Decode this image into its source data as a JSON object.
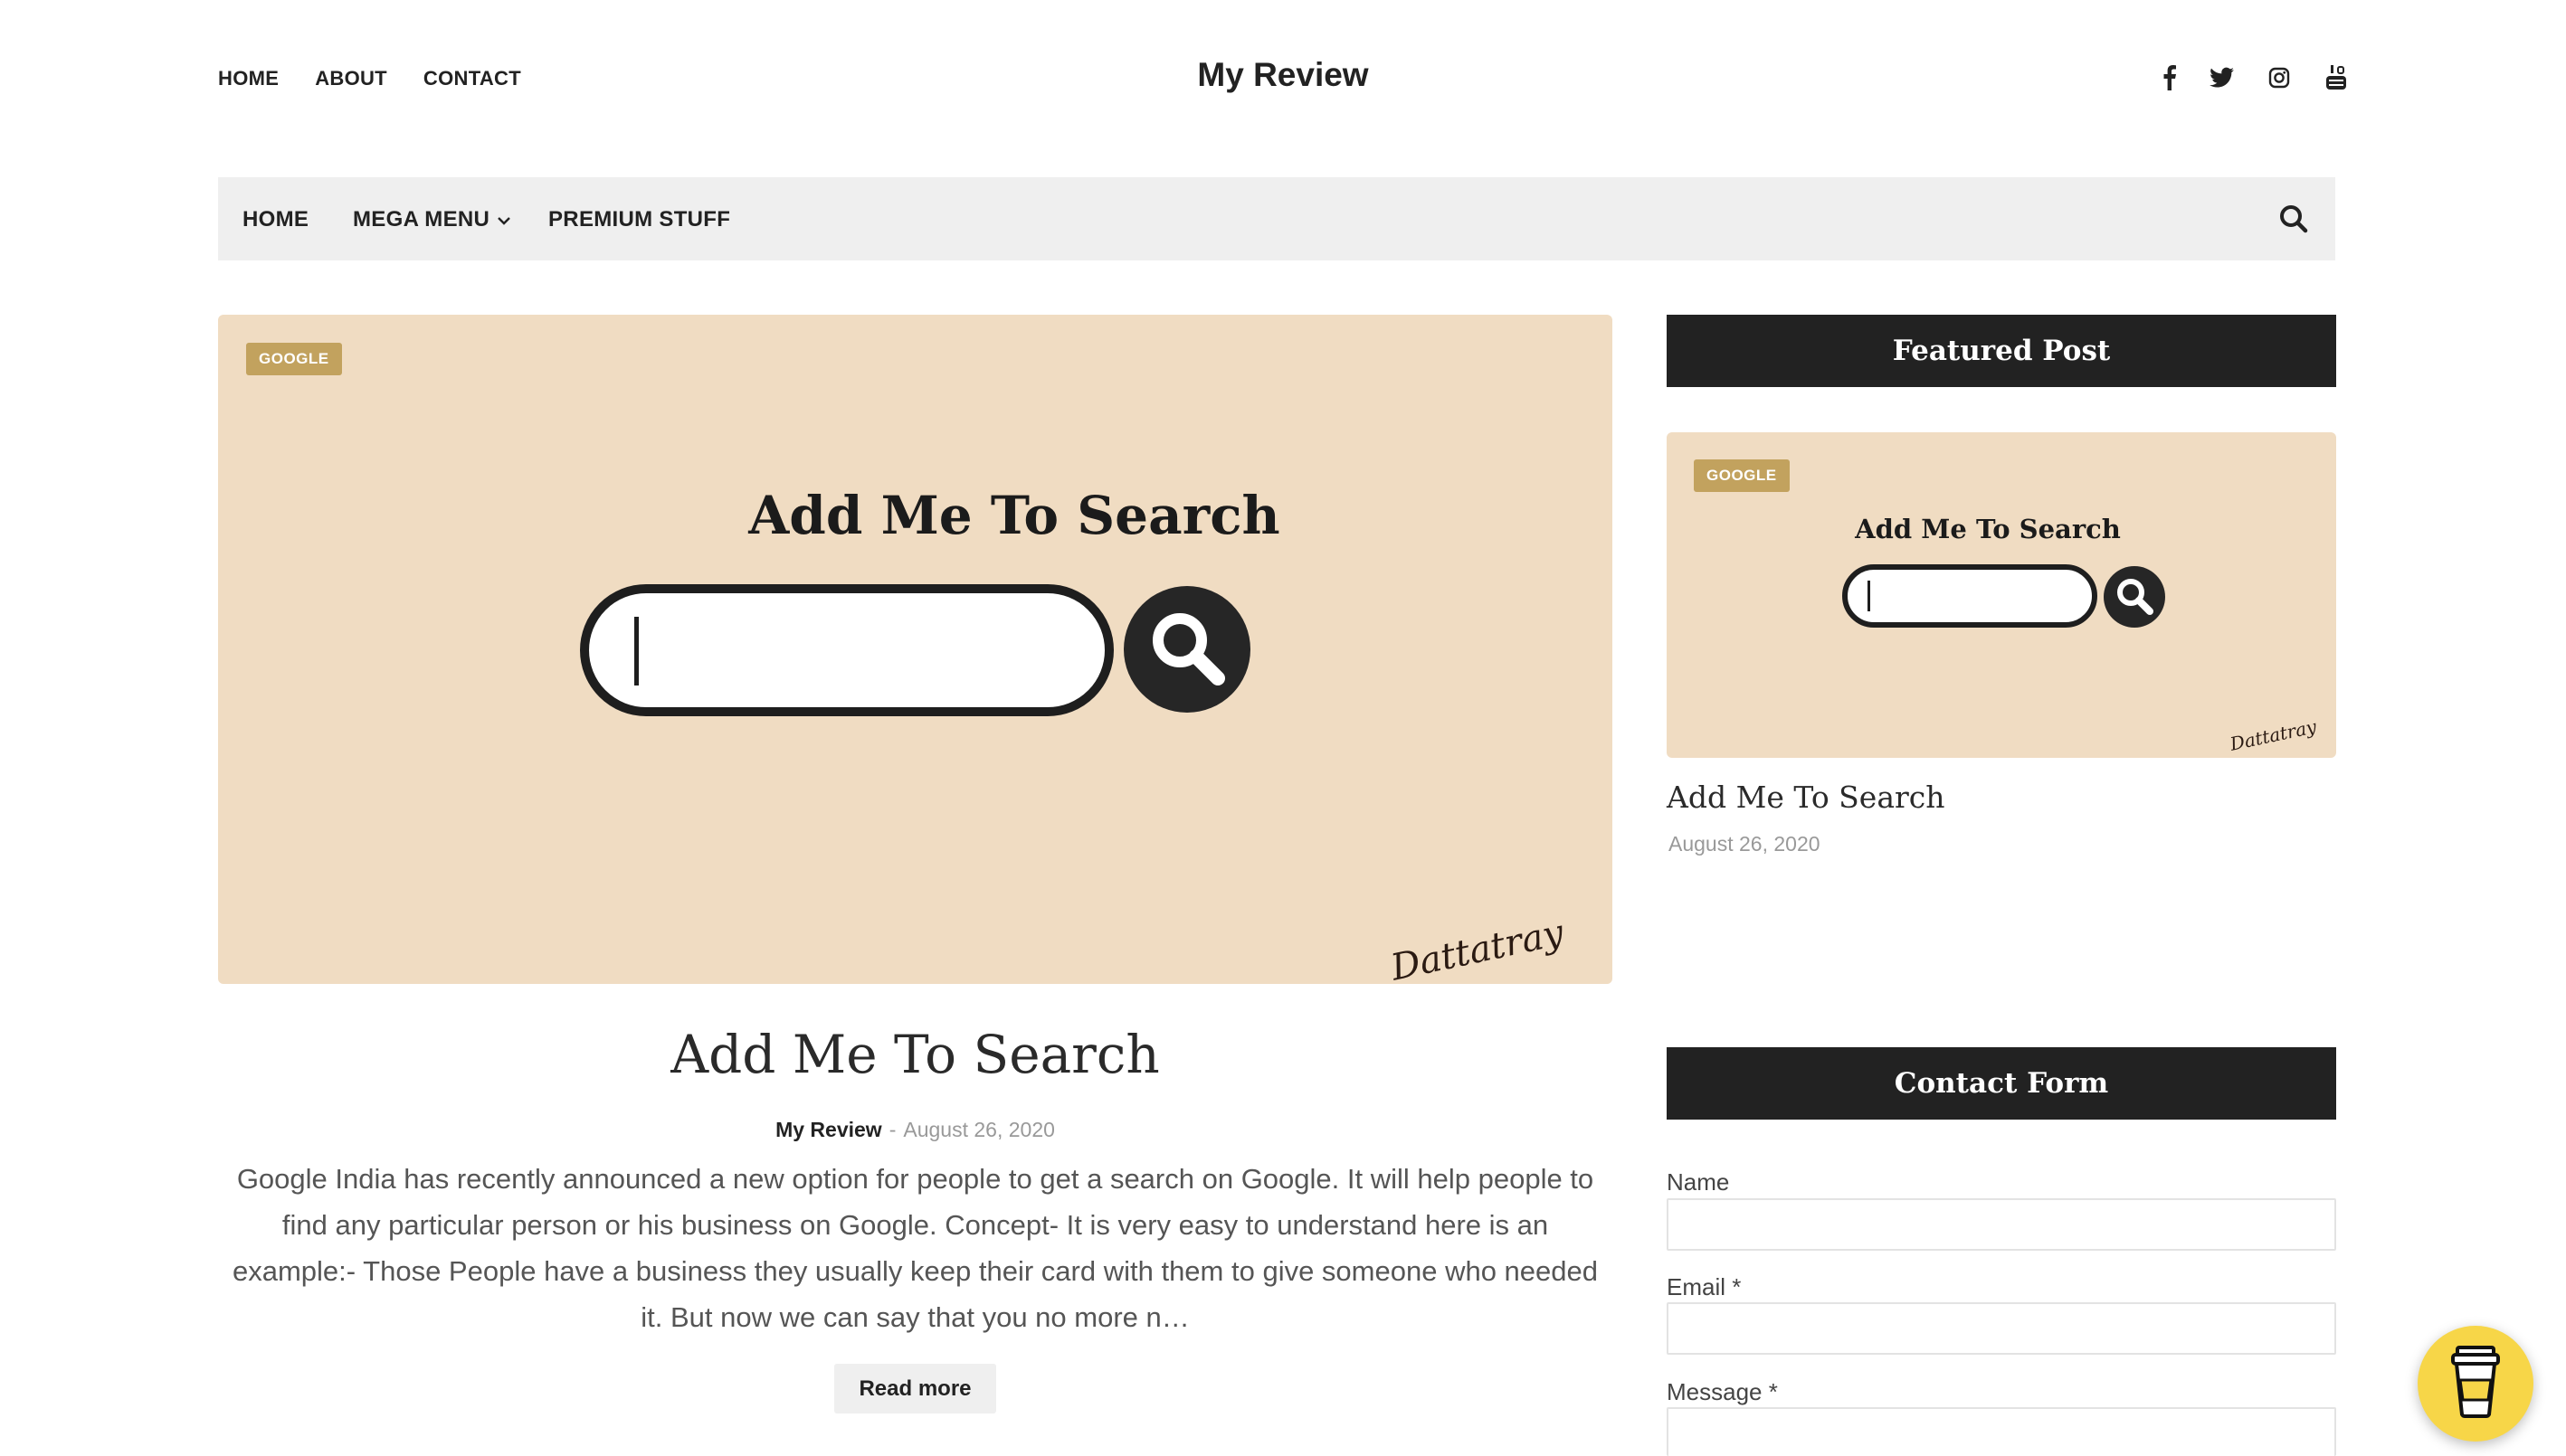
{
  "top_links": [
    "HOME",
    "ABOUT",
    "CONTACT"
  ],
  "site_title": "My Review",
  "social_icons": [
    "facebook-icon",
    "twitter-icon",
    "instagram-icon",
    "youtube-icon"
  ],
  "nav": {
    "items": [
      "HOME",
      "MEGA MENU",
      "PREMIUM STUFF"
    ],
    "search_icon": "search-icon"
  },
  "hero": {
    "badge": "GOOGLE",
    "image_heading": "Add Me To Search",
    "image_signature": "Dattatray"
  },
  "post": {
    "title": "Add Me To Search",
    "author": "My Review",
    "separator": "-",
    "date": "August 26, 2020",
    "excerpt": "Google India has recently announced a new option for people to get a search on Google. It will help people to find any particular person or his business on Google.  Concept-      It is very easy to understand here is an example:- Those People have a business they usually keep their card with them to give someone who needed it. But now we can say that you no more n…",
    "read_more": "Read more"
  },
  "sidebar": {
    "featured": {
      "heading": "Featured Post",
      "badge": "GOOGLE",
      "image_heading": "Add Me To Search",
      "image_signature": "Dattatray",
      "title": "Add Me To Search",
      "date": "August 26, 2020"
    },
    "contact": {
      "heading": "Contact Form",
      "name_label": "Name",
      "email_label": "Email *",
      "message_label": "Message *"
    }
  },
  "colors": {
    "image_bg": "#f0dcc2",
    "badge": "#c2a25e",
    "widget_head": "#222222",
    "nav_bg": "#efefef",
    "coffee_button": "#f7d648"
  }
}
